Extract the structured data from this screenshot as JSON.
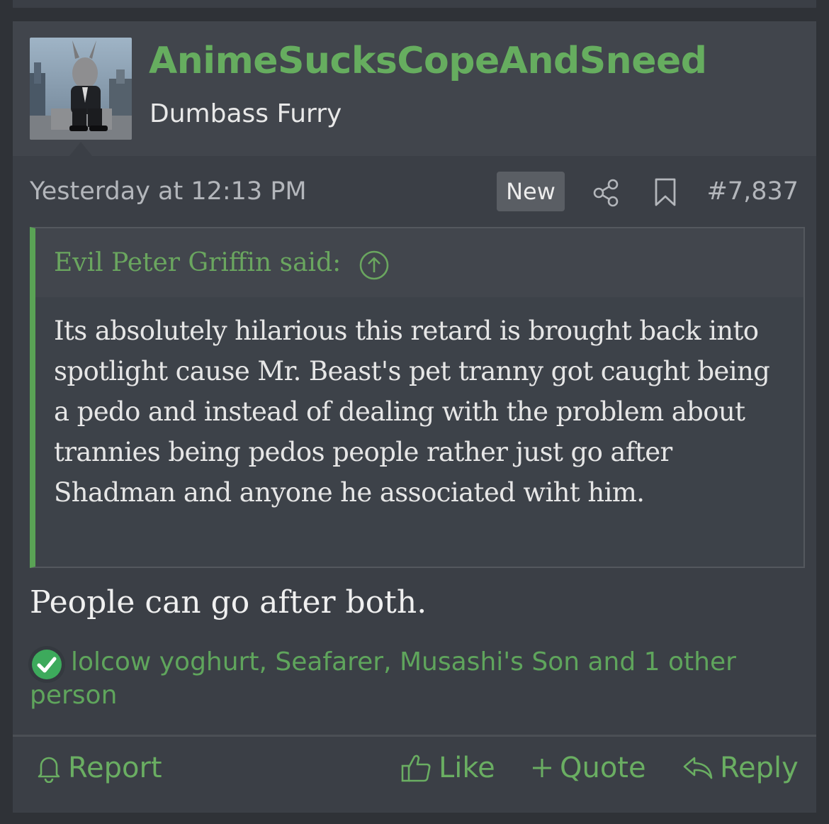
{
  "colors": {
    "accent": "#66ad5f",
    "quote_border": "#5aa355",
    "panel": "#3b3f46"
  },
  "user": {
    "name": "AnimeSucksCopeAndSneed",
    "title": "Dumbass Furry",
    "avatar_icon": "avatar-image"
  },
  "meta": {
    "date": "Yesterday at 12:13 PM",
    "badge": "New",
    "share_icon": "share-icon",
    "bookmark_icon": "bookmark-icon",
    "post_number": "#7,837"
  },
  "quote": {
    "author": "Evil Peter Griffin said:",
    "jump_icon": "arrow-up-circle-icon",
    "text": "Its absolutely hilarious this retard is brought back into spotlight cause Mr. Beast's pet tranny got caught being a pedo and instead of dealing with the problem about trannies being pedos people rather just go after Shadman and anyone he associated wiht him."
  },
  "body": "People can go after both.",
  "reactions": {
    "icon": "check-circle-icon",
    "text": "lolcow yoghurt, Seafarer, Musashi's Son and 1 other person"
  },
  "actions": {
    "report": "Report",
    "like": "Like",
    "quote": "Quote",
    "reply": "Reply"
  }
}
